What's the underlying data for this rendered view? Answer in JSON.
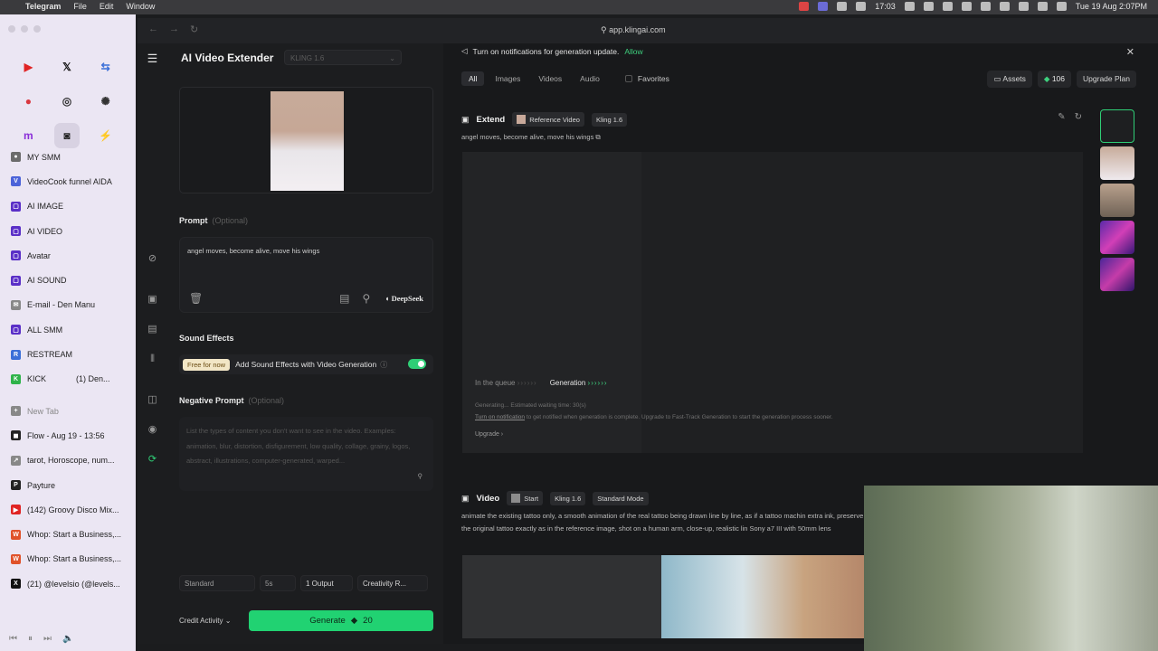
{
  "menubar": {
    "app": "Telegram",
    "items": [
      "File",
      "Edit",
      "Window"
    ],
    "time": "17:03",
    "date": "Tue 19 Aug  2:07PM"
  },
  "sidebar": {
    "favorites": [
      {
        "icon": "youtube-icon",
        "glyph": "▶",
        "color": "#e02424"
      },
      {
        "icon": "x-icon",
        "glyph": "𝕏",
        "color": "#111111"
      },
      {
        "icon": "translate-icon",
        "glyph": "⇆",
        "color": "#3b6fd8"
      },
      {
        "icon": "app-icon",
        "glyph": "●",
        "color": "#d9383f"
      },
      {
        "icon": "circle-icon",
        "glyph": "◎",
        "color": "#333333"
      },
      {
        "icon": "openai-icon",
        "glyph": "✺",
        "color": "#333333"
      },
      {
        "icon": "m-icon",
        "glyph": "m",
        "color": "#8b2fd8"
      },
      {
        "icon": "instagram-icon",
        "glyph": "◙",
        "color": "#222222"
      },
      {
        "icon": "grok-icon",
        "glyph": "⚡",
        "color": "#222222"
      }
    ],
    "items": [
      {
        "label": "MY SMM",
        "color": "#6b6b6b",
        "glyph": "●"
      },
      {
        "label": "VideoCook funnel AIDA",
        "color": "#4b63d9",
        "glyph": "V"
      },
      {
        "label": "AI IMAGE",
        "color": "#5a2fc7",
        "glyph": "▢"
      },
      {
        "label": "AI VIDEO",
        "color": "#5a2fc7",
        "glyph": "▢"
      },
      {
        "label": "Avatar",
        "color": "#5a2fc7",
        "glyph": "▢"
      },
      {
        "label": "AI SOUND",
        "color": "#5a2fc7",
        "glyph": "▢"
      },
      {
        "label": "E-mail - Den Manu",
        "color": "#888888",
        "glyph": "✉"
      },
      {
        "label": "ALL SMM",
        "color": "#5a2fc7",
        "glyph": "▢"
      },
      {
        "label": "RESTREAM",
        "color": "#3b6fd8",
        "glyph": "R"
      },
      {
        "label": "KICK",
        "color": "#2fb34a",
        "glyph": "K"
      },
      {
        "label": "New Tab",
        "color": "#888888",
        "glyph": "+"
      },
      {
        "label": "Flow - Aug 19 - 13:56",
        "color": "#222222",
        "glyph": "◼"
      },
      {
        "label": "tarot, Horoscope, num...",
        "color": "#888888",
        "glyph": "↗"
      },
      {
        "label": "Payture",
        "color": "#222222",
        "glyph": "P"
      },
      {
        "label": "(142) Groovy Disco Mix...",
        "color": "#e02424",
        "glyph": "▶"
      },
      {
        "label": "Whop: Start a Business,...",
        "color": "#e0522a",
        "glyph": "W"
      },
      {
        "label": "Whop: Start a Business,...",
        "color": "#e0522a",
        "glyph": "W"
      },
      {
        "label": "(21) @levelsio (@levels...",
        "color": "#111111",
        "glyph": "X"
      }
    ],
    "kick_side": "(1) Den..."
  },
  "browser": {
    "url": "app.klingai.com"
  },
  "panel": {
    "title": "AI Video Extender",
    "model": "KLING 1.6",
    "prompt_label": "Prompt",
    "optional": "(Optional)",
    "prompt_text": "angel moves, become alive, move his wings",
    "deepseek": "DeepSeek",
    "sound_label": "Sound Effects",
    "free_tag": "Free for now",
    "sound_text": "Add Sound Effects with Video Generation",
    "sound_on": true,
    "neg_label": "Negative Prompt",
    "neg_placeholder": "List the types of content you don't want to see in the video. Examples: animation, blur, distortion, disfigurement, low quality, collage, grainy, logos, abstract, illustrations, computer-generated, warped...",
    "options": [
      "Standard",
      "5s",
      "1 Output",
      "Creativity R..."
    ],
    "credit": "Credit Activity",
    "generate": "Generate",
    "cost": "20"
  },
  "main": {
    "notification": "Turn on notifications for generation update.",
    "allow": "Allow",
    "tabs": [
      "All",
      "Images",
      "Videos",
      "Audio"
    ],
    "favorites": "Favorites",
    "assets": "Assets",
    "credits": "106",
    "upgrade_plan": "Upgrade Plan",
    "extend": {
      "title": "Extend",
      "chip1": "Reference Video",
      "chip2": "Kling 1.6",
      "prompt": "angel moves, become alive, move his wings",
      "queue": "In the queue",
      "generation": "Generation",
      "status": "Generating... Estimated waiting time: 30(s)",
      "notify_link": "Turn on notification",
      "notify_rest": " to get notified when generation is complete. Upgrade to Fast-Track Generation to start the generation process sooner.",
      "upgrade": "Upgrade"
    },
    "video": {
      "title": "Video",
      "chip1": "Start",
      "chip2": "Kling 1.6",
      "chip3": "Standard Mode",
      "prompt": "animate the existing tattoo only, a smooth animation of the real tattoo being drawn line by line, as if a tattoo machin extra ink, preserve the original tattoo exactly as in the reference image, shot on a human arm, close-up, realistic lin Sony a7 III with 50mm lens"
    }
  },
  "colors": {
    "accent": "#21d272",
    "bg": "#18191b",
    "panel": "#1c1d1f"
  }
}
